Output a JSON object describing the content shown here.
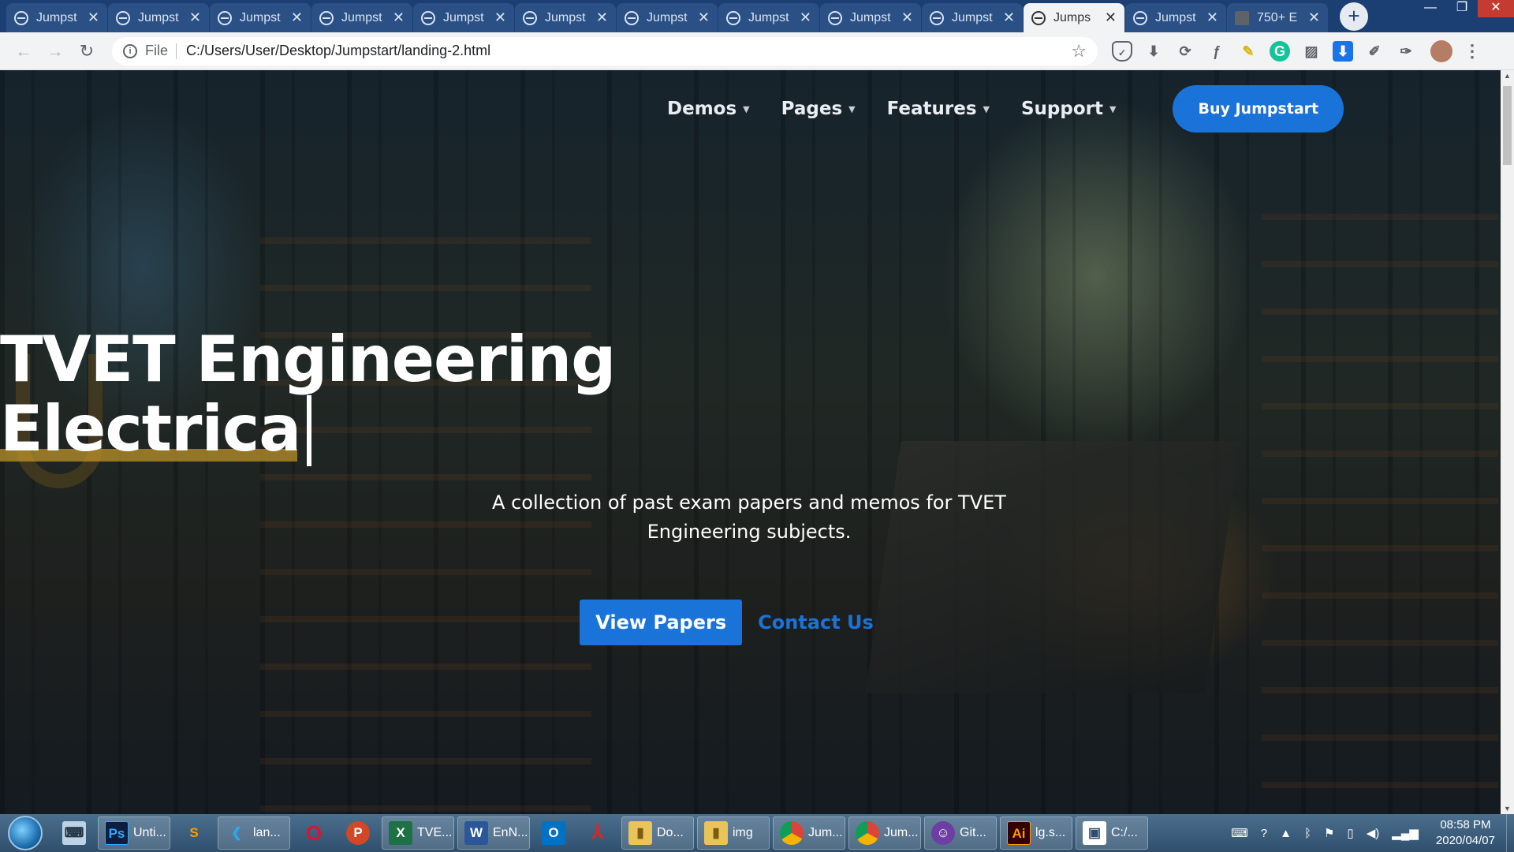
{
  "browser": {
    "tabs": [
      {
        "title": "Jumpst",
        "active": false
      },
      {
        "title": "Jumpst",
        "active": false
      },
      {
        "title": "Jumpst",
        "active": false
      },
      {
        "title": "Jumpst",
        "active": false
      },
      {
        "title": "Jumpst",
        "active": false
      },
      {
        "title": "Jumpst",
        "active": false
      },
      {
        "title": "Jumpst",
        "active": false
      },
      {
        "title": "Jumpst",
        "active": false
      },
      {
        "title": "Jumpst",
        "active": false
      },
      {
        "title": "Jumpst",
        "active": false
      },
      {
        "title": "Jumps",
        "active": true
      },
      {
        "title": "Jumpst",
        "active": false
      },
      {
        "title": "750+ E",
        "active": false
      }
    ],
    "new_tab_label": "+",
    "address": {
      "scheme": "File",
      "url": "C:/Users/User/Desktop/Jumpstart/landing-2.html"
    }
  },
  "site": {
    "nav": [
      {
        "label": "Demos"
      },
      {
        "label": "Pages"
      },
      {
        "label": "Features"
      },
      {
        "label": "Support"
      }
    ],
    "buy_label": "Buy Jumpstart",
    "hero": {
      "title_line1": "TVET Engineering",
      "title_line2": "Electrica",
      "subtitle": "A collection of past exam papers and memos for TVET Engineering subjects.",
      "primary_cta": "View Papers",
      "secondary_cta": "Contact Us"
    }
  },
  "taskbar": {
    "windows": [
      {
        "name": "photoshop",
        "label": "Unti..."
      },
      {
        "name": "vscode",
        "label": "lan..."
      },
      {
        "name": "excel",
        "label": "TVE..."
      },
      {
        "name": "word",
        "label": "EnN..."
      },
      {
        "name": "explorer-docs",
        "label": "Do..."
      },
      {
        "name": "explorer-img",
        "label": "img"
      },
      {
        "name": "chrome-1",
        "label": "Jum..."
      },
      {
        "name": "chrome-2",
        "label": "Jum..."
      },
      {
        "name": "github",
        "label": "Git..."
      },
      {
        "name": "illustrator",
        "label": "lg.s..."
      },
      {
        "name": "terminal",
        "label": "C:/..."
      }
    ],
    "time": "08:58 PM",
    "date": "2020/04/07"
  },
  "colors": {
    "accent": "#1a73d9",
    "highlight": "#c49a28",
    "tabstrip": "#1c3f73"
  }
}
